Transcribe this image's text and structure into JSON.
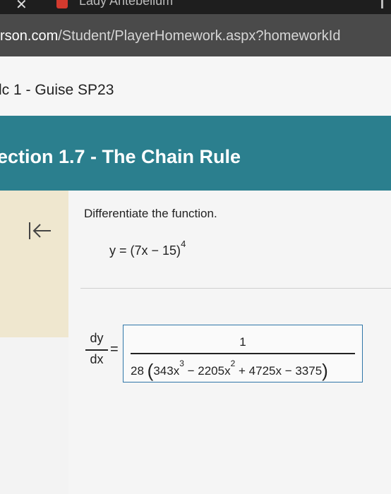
{
  "browser": {
    "tab_title": "Lady Antebellum",
    "url_host": "rson.com",
    "url_path": "/Student/PlayerHomework.aspx?homeworkId"
  },
  "course": {
    "title": "lc 1 - Guise SP23"
  },
  "section": {
    "title": "ection 1.7 - The Chain Rule"
  },
  "problem": {
    "prompt": "Differentiate the function.",
    "function_lhs": "y = (7x − 15)",
    "function_exponent": "4"
  },
  "answer": {
    "lhs_numerator": "dy",
    "lhs_denominator": "dx",
    "equals": "=",
    "numerator": "1",
    "den_coeff": "28",
    "den_term1": "343x",
    "den_exp1": "3",
    "den_term2": " − 2205x",
    "den_exp2": "2",
    "den_term3": " + 4725x − 3375"
  },
  "colors": {
    "section_bar": "#2b7f8e",
    "left_pane": "#efe7cf",
    "answer_border": "#2f76a8"
  }
}
